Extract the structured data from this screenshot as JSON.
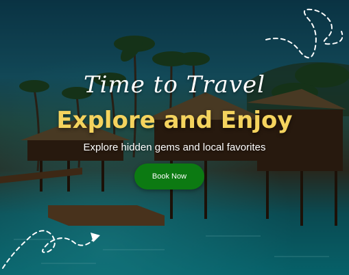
{
  "hero": {
    "script_title": "Time to Travel",
    "title": "Explore and Enjoy",
    "subtitle": "Explore hidden gems and local favorites",
    "cta_label": "Book Now"
  },
  "colors": {
    "title": "#f4d35e",
    "cta": "#0c7a12",
    "text": "#ffffff"
  },
  "decorations": {
    "top_right": "dashed-loop-path",
    "bottom_left": "dashed-arrow-path"
  }
}
